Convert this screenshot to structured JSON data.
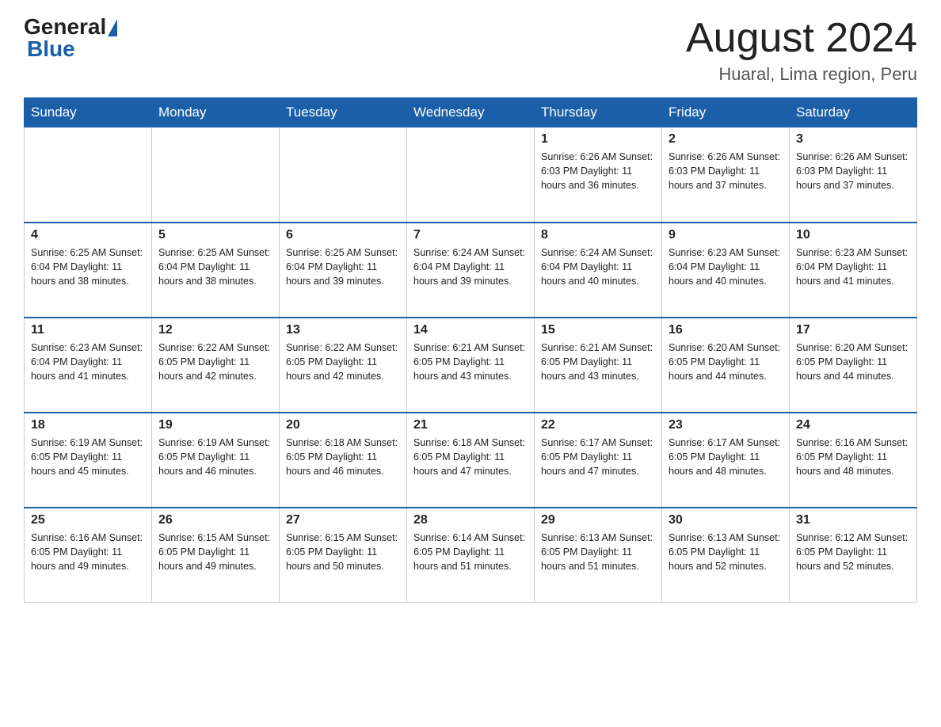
{
  "logo": {
    "general": "General",
    "blue": "Blue"
  },
  "header": {
    "month": "August 2024",
    "location": "Huaral, Lima region, Peru"
  },
  "days_of_week": [
    "Sunday",
    "Monday",
    "Tuesday",
    "Wednesday",
    "Thursday",
    "Friday",
    "Saturday"
  ],
  "weeks": [
    [
      {
        "day": "",
        "info": ""
      },
      {
        "day": "",
        "info": ""
      },
      {
        "day": "",
        "info": ""
      },
      {
        "day": "",
        "info": ""
      },
      {
        "day": "1",
        "info": "Sunrise: 6:26 AM\nSunset: 6:03 PM\nDaylight: 11 hours and 36 minutes."
      },
      {
        "day": "2",
        "info": "Sunrise: 6:26 AM\nSunset: 6:03 PM\nDaylight: 11 hours and 37 minutes."
      },
      {
        "day": "3",
        "info": "Sunrise: 6:26 AM\nSunset: 6:03 PM\nDaylight: 11 hours and 37 minutes."
      }
    ],
    [
      {
        "day": "4",
        "info": "Sunrise: 6:25 AM\nSunset: 6:04 PM\nDaylight: 11 hours and 38 minutes."
      },
      {
        "day": "5",
        "info": "Sunrise: 6:25 AM\nSunset: 6:04 PM\nDaylight: 11 hours and 38 minutes."
      },
      {
        "day": "6",
        "info": "Sunrise: 6:25 AM\nSunset: 6:04 PM\nDaylight: 11 hours and 39 minutes."
      },
      {
        "day": "7",
        "info": "Sunrise: 6:24 AM\nSunset: 6:04 PM\nDaylight: 11 hours and 39 minutes."
      },
      {
        "day": "8",
        "info": "Sunrise: 6:24 AM\nSunset: 6:04 PM\nDaylight: 11 hours and 40 minutes."
      },
      {
        "day": "9",
        "info": "Sunrise: 6:23 AM\nSunset: 6:04 PM\nDaylight: 11 hours and 40 minutes."
      },
      {
        "day": "10",
        "info": "Sunrise: 6:23 AM\nSunset: 6:04 PM\nDaylight: 11 hours and 41 minutes."
      }
    ],
    [
      {
        "day": "11",
        "info": "Sunrise: 6:23 AM\nSunset: 6:04 PM\nDaylight: 11 hours and 41 minutes."
      },
      {
        "day": "12",
        "info": "Sunrise: 6:22 AM\nSunset: 6:05 PM\nDaylight: 11 hours and 42 minutes."
      },
      {
        "day": "13",
        "info": "Sunrise: 6:22 AM\nSunset: 6:05 PM\nDaylight: 11 hours and 42 minutes."
      },
      {
        "day": "14",
        "info": "Sunrise: 6:21 AM\nSunset: 6:05 PM\nDaylight: 11 hours and 43 minutes."
      },
      {
        "day": "15",
        "info": "Sunrise: 6:21 AM\nSunset: 6:05 PM\nDaylight: 11 hours and 43 minutes."
      },
      {
        "day": "16",
        "info": "Sunrise: 6:20 AM\nSunset: 6:05 PM\nDaylight: 11 hours and 44 minutes."
      },
      {
        "day": "17",
        "info": "Sunrise: 6:20 AM\nSunset: 6:05 PM\nDaylight: 11 hours and 44 minutes."
      }
    ],
    [
      {
        "day": "18",
        "info": "Sunrise: 6:19 AM\nSunset: 6:05 PM\nDaylight: 11 hours and 45 minutes."
      },
      {
        "day": "19",
        "info": "Sunrise: 6:19 AM\nSunset: 6:05 PM\nDaylight: 11 hours and 46 minutes."
      },
      {
        "day": "20",
        "info": "Sunrise: 6:18 AM\nSunset: 6:05 PM\nDaylight: 11 hours and 46 minutes."
      },
      {
        "day": "21",
        "info": "Sunrise: 6:18 AM\nSunset: 6:05 PM\nDaylight: 11 hours and 47 minutes."
      },
      {
        "day": "22",
        "info": "Sunrise: 6:17 AM\nSunset: 6:05 PM\nDaylight: 11 hours and 47 minutes."
      },
      {
        "day": "23",
        "info": "Sunrise: 6:17 AM\nSunset: 6:05 PM\nDaylight: 11 hours and 48 minutes."
      },
      {
        "day": "24",
        "info": "Sunrise: 6:16 AM\nSunset: 6:05 PM\nDaylight: 11 hours and 48 minutes."
      }
    ],
    [
      {
        "day": "25",
        "info": "Sunrise: 6:16 AM\nSunset: 6:05 PM\nDaylight: 11 hours and 49 minutes."
      },
      {
        "day": "26",
        "info": "Sunrise: 6:15 AM\nSunset: 6:05 PM\nDaylight: 11 hours and 49 minutes."
      },
      {
        "day": "27",
        "info": "Sunrise: 6:15 AM\nSunset: 6:05 PM\nDaylight: 11 hours and 50 minutes."
      },
      {
        "day": "28",
        "info": "Sunrise: 6:14 AM\nSunset: 6:05 PM\nDaylight: 11 hours and 51 minutes."
      },
      {
        "day": "29",
        "info": "Sunrise: 6:13 AM\nSunset: 6:05 PM\nDaylight: 11 hours and 51 minutes."
      },
      {
        "day": "30",
        "info": "Sunrise: 6:13 AM\nSunset: 6:05 PM\nDaylight: 11 hours and 52 minutes."
      },
      {
        "day": "31",
        "info": "Sunrise: 6:12 AM\nSunset: 6:05 PM\nDaylight: 11 hours and 52 minutes."
      }
    ]
  ]
}
